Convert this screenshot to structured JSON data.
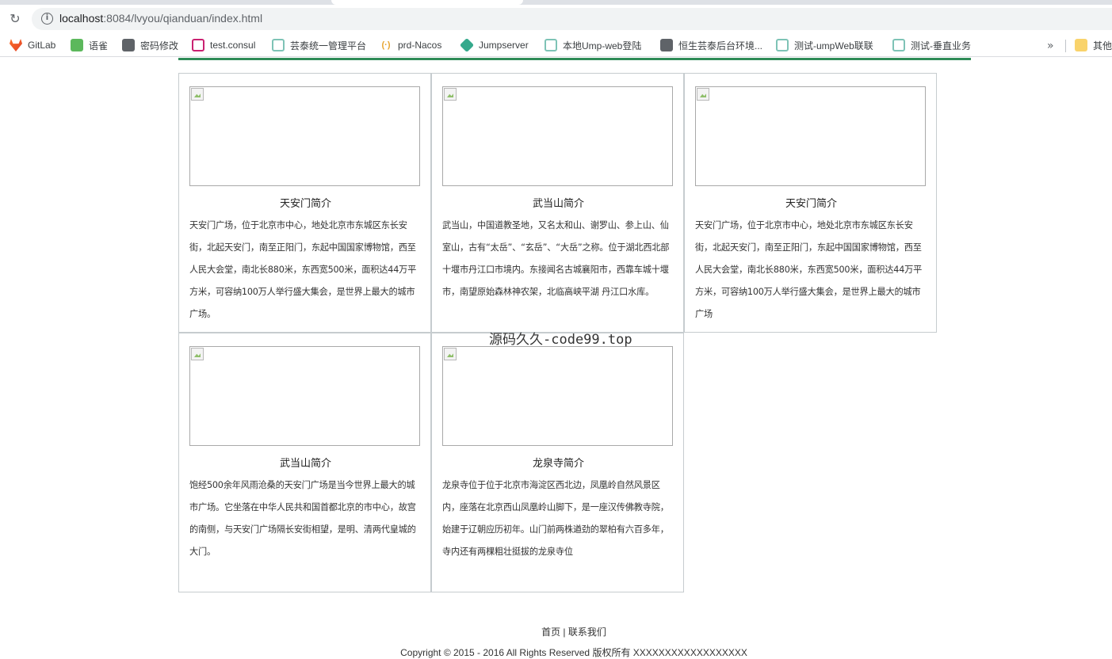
{
  "browser": {
    "url_host": "localhost",
    "url_rest": ":8084/lvyou/qianduan/index.html",
    "bookmarks": [
      {
        "label": "GitLab",
        "icon": "gitlab-icon"
      },
      {
        "label": "语雀",
        "icon": "leaf-icon"
      },
      {
        "label": "密码修改",
        "icon": "globe-icon"
      },
      {
        "label": "test.consul",
        "icon": "consul-icon"
      },
      {
        "label": "芸泰统一管理平台",
        "icon": "cloud-icon"
      },
      {
        "label": "prd-Nacos",
        "icon": "nacos-icon"
      },
      {
        "label": "Jumpserver",
        "icon": "jumpserver-icon"
      },
      {
        "label": "本地Ump-web登陆",
        "icon": "cloud-icon"
      },
      {
        "label": "恒生芸泰后台环境...",
        "icon": "globe-icon"
      },
      {
        "label": "测试-umpWeb联联",
        "icon": "cloud-icon"
      },
      {
        "label": "测试-垂直业务",
        "icon": "cloud-icon"
      }
    ],
    "more_label": "»",
    "other_label": "其他"
  },
  "cards": [
    {
      "title": "天安门简介",
      "desc": "天安门广场，位于北京市中心，地处北京市东城区东长安街，北起天安门，南至正阳门，东起中国国家博物馆，西至人民大会堂，南北长880米，东西宽500米，面积达44万平方米，可容纳100万人举行盛大集会，是世界上最大的城市广场。"
    },
    {
      "title": "武当山简介",
      "desc": "武当山，中国道教圣地，又名太和山、谢罗山、参上山、仙室山，古有“太岳”、“玄岳”、“大岳”之称。位于湖北西北部十堰市丹江口市境内。东接闻名古城襄阳市，西靠车城十堰市，南望原始森林神农架，北临高峡平湖 丹江口水库。"
    },
    {
      "title": "天安门简介",
      "desc": "天安门广场，位于北京市中心，地处北京市东城区东长安街，北起天安门，南至正阳门，东起中国国家博物馆，西至人民大会堂，南北长880米，东西宽500米，面积达44万平方米，可容纳100万人举行盛大集会，是世界上最大的城市广场"
    },
    {
      "title": "武当山简介",
      "desc": "饱经500余年风雨沧桑的天安门广场是当今世界上最大的城市广场。它坐落在中华人民共和国首都北京的市中心，故宫的南侧，与天安门广场隔长安街相望，是明、清两代皇城的大门。"
    },
    {
      "title": "龙泉寺简介",
      "desc": "龙泉寺位于位于北京市海淀区西北边，凤凰岭自然风景区内，座落在北京西山凤凰岭山脚下，是一座汉传佛教寺院，始建于辽朝应历初年。山门前两株遒劲的翠柏有六百多年，寺内还有两棵粗壮挺拔的龙泉寺位"
    }
  ],
  "watermark": "源码久久-code99.top",
  "footer": {
    "home": "首页",
    "sep": " | ",
    "contact": "联系我们",
    "copyright": "Copyright © 2015 - 2016 All Rights Reserved 版权所有 XXXXXXXXXXXXXXXXXX"
  },
  "colors": {
    "accent_line": "#2e8b57",
    "card_border": "#c6cccf"
  }
}
